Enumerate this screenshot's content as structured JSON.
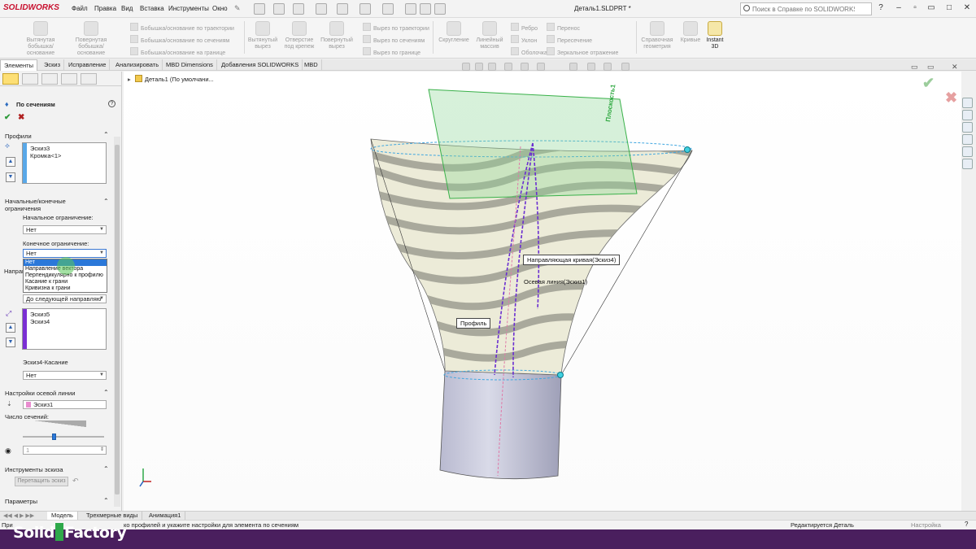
{
  "app": {
    "logo": "SOLIDWORKS",
    "document_title": "Деталь1.SLDPRT *"
  },
  "menu": [
    "Файл",
    "Правка",
    "Вид",
    "Вставка",
    "Инструменты",
    "Окно"
  ],
  "help_search": {
    "placeholder": "Поиск в Справке по SOLIDWORKS"
  },
  "ribbon": {
    "big_buttons": [
      {
        "label": "Вытянутая бобышка/основание"
      },
      {
        "label": "Повернутая бобышка/основание"
      },
      {
        "label": "Вытянутый вырез"
      },
      {
        "label": "Отверстие под крепеж"
      },
      {
        "label": "Повернутый вырез"
      },
      {
        "label": "Скругление"
      },
      {
        "label": "Линейный массив"
      },
      {
        "label": "Справочная геометрия"
      },
      {
        "label": "Кривые"
      }
    ],
    "small_buttons": [
      "Бобышка/основание по траектории",
      "Бобышка/основание по сечениям",
      "Бобышка/основание на границе",
      "Вырез по траектории",
      "Вырез по сечениям",
      "Вырез по границе",
      "Ребро",
      "Уклон",
      "Оболочка",
      "Перенос",
      "Пересечение",
      "Зеркальное отражение"
    ],
    "instant3d": "Instant 3D"
  },
  "command_tabs": [
    "Элементы",
    "Эскиз",
    "Исправление",
    "Анализировать",
    "MBD Dimensions",
    "Добавления SOLIDWORKS",
    "MBD"
  ],
  "feature_tree_crumb": "Деталь1  (По умолчани...",
  "property_manager": {
    "title": "По сечениям",
    "profiles": {
      "header": "Профили",
      "items": [
        "Эскиз3",
        "Кромка<1>"
      ]
    },
    "constraints": {
      "header": "Начальные/конечные ограничения",
      "start_label": "Начальное ограничение:",
      "start_value": "Нет",
      "end_label": "Конечное ограничение:",
      "end_value": "Нет",
      "dropdown_options": [
        "Нет",
        "Направление вектора",
        "Перпендикулярно к профилю",
        "Касание к грани",
        "Кривизна к грани"
      ]
    },
    "guides": {
      "header_fragment": "Направ",
      "mode_value": "До следующей направляю",
      "items": [
        "Эскиз5",
        "Эскиз4"
      ],
      "tangency_label": "Эскиз4-Касание",
      "tangency_value": "Нет"
    },
    "centerline": {
      "header": "Настройки осевой линии",
      "value": "Эскиз1",
      "sections_label": "Число сечений:",
      "sections_value": "1"
    },
    "sketch_tools": {
      "header": "Инструменты эскиза",
      "drag_button": "Перетащить эскиз"
    },
    "options": {
      "header": "Параметры"
    }
  },
  "callouts": {
    "plane": "Плоскость1",
    "guide_curve": "Направляющая кривая(Эскиз4)",
    "center_line": "Осевая линия(Эскиз1)",
    "profile": "Профиль"
  },
  "bottom_tabs": [
    "Модель",
    "Трехмерные виды",
    "Анимация1"
  ],
  "status": {
    "message_left": "При",
    "message": "ко профилей и укажите настройки для элемента по сечениям",
    "editing": "Редактируется Деталь",
    "settings": "Настройка"
  },
  "watermark": {
    "left": "Solid",
    "right": "Factory"
  }
}
